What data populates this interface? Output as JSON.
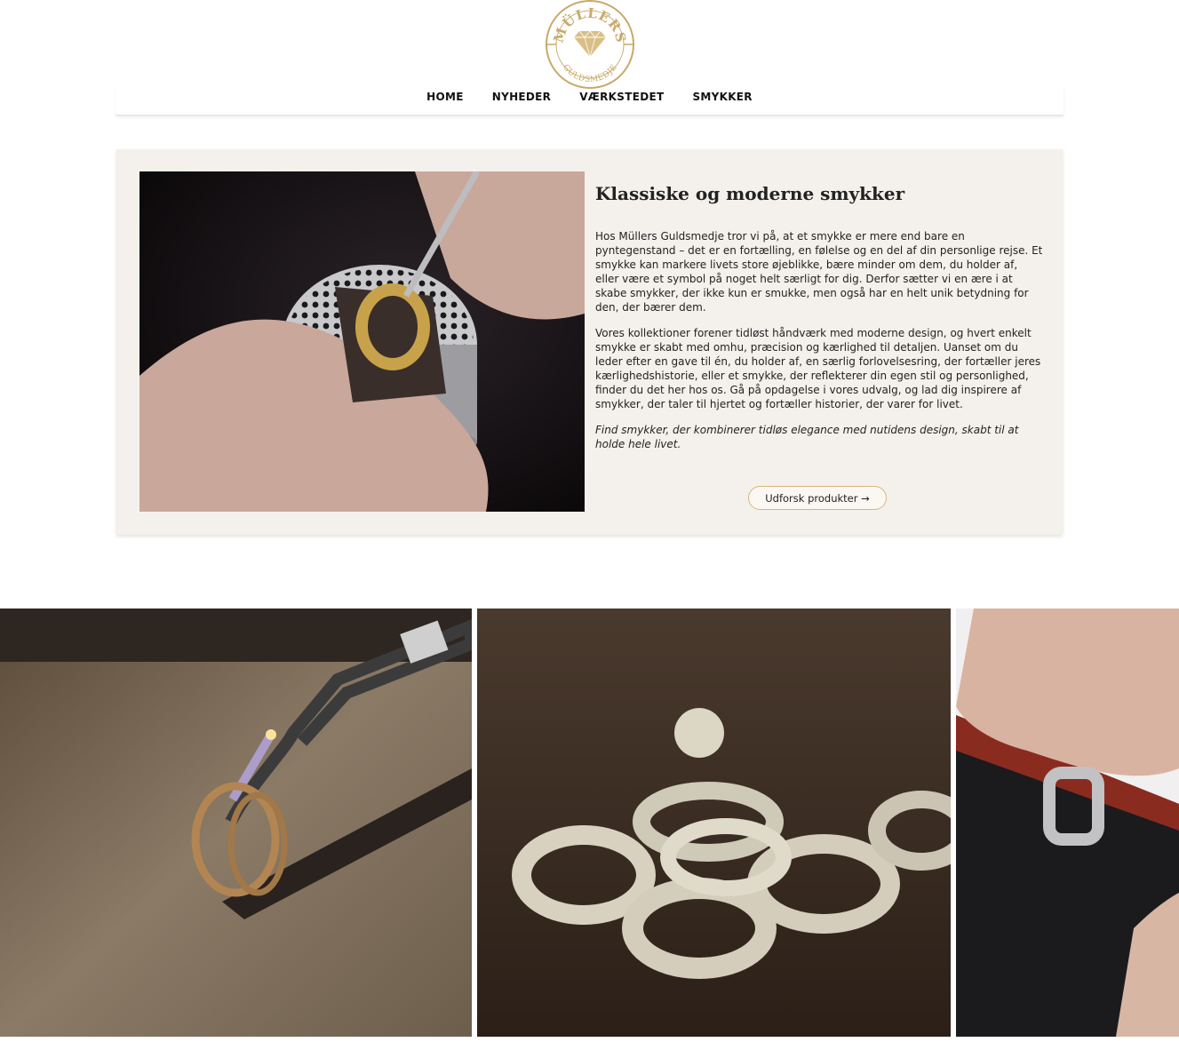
{
  "logo": {
    "name": "MÜLLERS",
    "subtitle": "GULDSMEDJE",
    "icon": "diamond-icon",
    "color": "#c8a96a"
  },
  "nav": {
    "items": [
      {
        "label": "HOME"
      },
      {
        "label": "NYHEDER"
      },
      {
        "label": "VÆRKSTEDET"
      },
      {
        "label": "SMYKKER"
      }
    ]
  },
  "feature": {
    "title": "Klassiske og moderne smykker",
    "paragraphs": [
      "Hos Müllers Guldsmedje tror vi på, at et smykke er mere end bare en pyntegenstand – det er en fortælling, en følelse og en del af din personlige rejse. Et smykke kan markere livets store øjeblikke, bære minder om dem, du holder af, eller være et symbol på noget helt særligt for dig. Derfor sætter vi en ære i at skabe smykker, der ikke kun er smukke, men også har en helt unik betydning for den, der bærer dem.",
      "Vores kollektioner forener tidløst håndværk med moderne design, og hvert enkelt smykke er skabt med omhu, præcision og kærlighed til detaljen. Uanset om du leder efter en gave til én, du holder af, en særlig forlovelsesring, der fortæller jeres kærlighedshistorie, eller et smykke, der reflekterer din egen stil og personlighed, finder du det her hos os. Gå på opdagelse i vores udvalg, og lad dig inspirere af smykker, der taler til hjertet og fortæller historier, der varer for livet."
    ],
    "tagline": "Find smykker, der kombinerer tidløs elegance med nutidens design, skabt til at holde hele livet.",
    "button_label": "Udforsk produkter →",
    "accent_color": "#d6b67a",
    "background": "#f4f1ec"
  }
}
